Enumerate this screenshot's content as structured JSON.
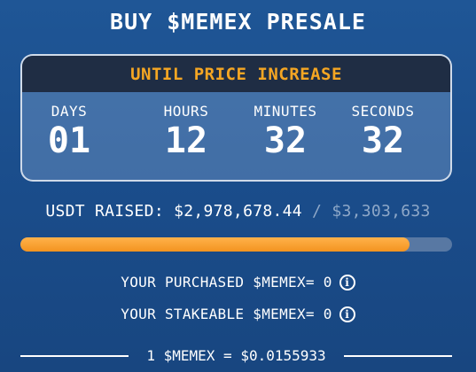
{
  "title": "BUY $MEMEX PRESALE",
  "timer": {
    "header": "UNTIL PRICE INCREASE",
    "units": [
      {
        "label": "DAYS",
        "value": "01"
      },
      {
        "label": "HOURS",
        "value": "12"
      },
      {
        "label": "MINUTES",
        "value": "32"
      },
      {
        "label": "SECONDS",
        "value": "32"
      }
    ]
  },
  "raised": {
    "label": "USDT RAISED:",
    "amount": "$2,978,678.44",
    "separator": "/",
    "goal": "$3,303,633"
  },
  "progress": {
    "fraction": 0.9016
  },
  "purchased": {
    "text": "YOUR PURCHASED $MEMEX= 0",
    "icon": "info-icon"
  },
  "stakeable": {
    "text": "YOUR STAKEABLE $MEMEX= 0",
    "icon": "info-icon"
  },
  "price": {
    "text": "1 $MEMEX = $0.0155933"
  },
  "colors": {
    "accent": "#f5a623",
    "background": "#1d4f8f",
    "header": "#1f2d44"
  }
}
